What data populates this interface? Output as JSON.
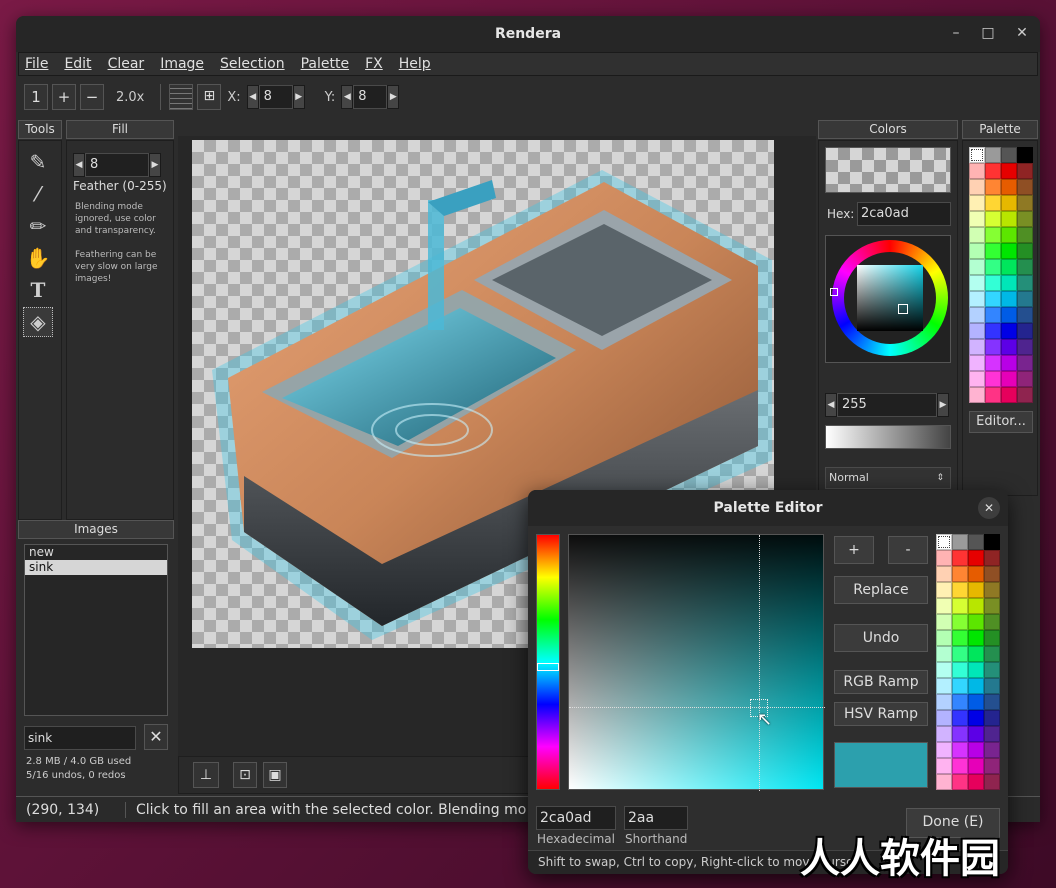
{
  "window": {
    "title": "Rendera"
  },
  "menu": [
    "File",
    "Edit",
    "Clear",
    "Image",
    "Selection",
    "Palette",
    "FX",
    "Help"
  ],
  "toolbar": {
    "one": "1",
    "plus": "+",
    "minus": "−",
    "zoom": "2.0x",
    "x_label": "X:",
    "x_value": "8",
    "y_label": "Y:",
    "y_value": "8"
  },
  "panels": {
    "tools": "Tools",
    "fill": "Fill",
    "images": "Images",
    "colors": "Colors",
    "palette": "Palette"
  },
  "fill": {
    "feather_value": "8",
    "feather_label": "Feather (0-255)",
    "note1": "Blending mode ignored, use color and transparency.",
    "note2": "Feathering can be very slow on large images!"
  },
  "images": {
    "items": [
      "new",
      "sink"
    ],
    "selected": "sink",
    "name_field": "sink",
    "memory": "2.8 MB / 4.0 GB used",
    "undos": "5/16 undos, 0 redos"
  },
  "colors": {
    "hex_label": "Hex:",
    "hex_value": "2ca0ad",
    "alpha_value": "255",
    "blend_mode": "Normal"
  },
  "palette_panel": {
    "editor_button": "Editor..."
  },
  "status": {
    "coords": "(290, 134)",
    "message": "Click to fill an area with the selected color. Blending mo"
  },
  "palette_editor": {
    "title": "Palette Editor",
    "add": "+",
    "remove": "-",
    "replace": "Replace",
    "undo": "Undo",
    "rgb_ramp": "RGB Ramp",
    "hsv_ramp": "HSV Ramp",
    "hex_value": "2ca0ad",
    "hex_caption": "Hexadecimal",
    "short_value": "2aa",
    "short_caption": "Shorthand",
    "done": "Done (E)",
    "hint": "Shift to swap, Ctrl to copy, Right-click to move cursor"
  },
  "watermark": "人人软件园",
  "colors_theme": {
    "selected": "#2ca0ad"
  }
}
